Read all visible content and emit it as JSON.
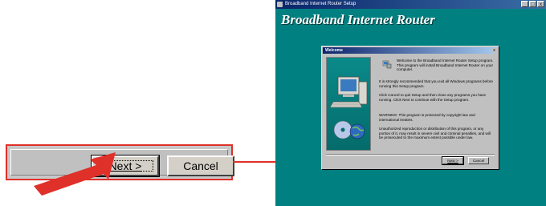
{
  "callout": {
    "next_label": "Next >",
    "cancel_label": "Cancel"
  },
  "setup_window": {
    "titlebar_text": "Broadband Internet Router Setup",
    "heading": "Broadband Internet Router",
    "titlebar_buttons": [
      "_",
      "□",
      "x"
    ]
  },
  "dialog": {
    "title": "Welcome",
    "close_label": "x",
    "paragraphs": [
      "Welcome to the Broadband Internet Router Setup program. This program will install Broadband Internet Router on your computer.",
      "It is strongly recommended that you exit all Windows programs before running this Setup program.",
      "Click Cancel to quit Setup and then close any programs you have running. Click Next to continue with the Setup program.",
      "WARNING: This program is protected by copyright law and international treaties.",
      "Unauthorized reproduction or distribution of this program, or any portion of it, may result in severe civil and criminal penalties, and will be prosecuted to the maximum extent possible under law."
    ],
    "next_label": "Next >",
    "cancel_label": "Cancel"
  },
  "colors": {
    "desktop_teal": "#008080",
    "callout_red": "#e0302a",
    "dialog_gray": "#c0c0c0"
  }
}
